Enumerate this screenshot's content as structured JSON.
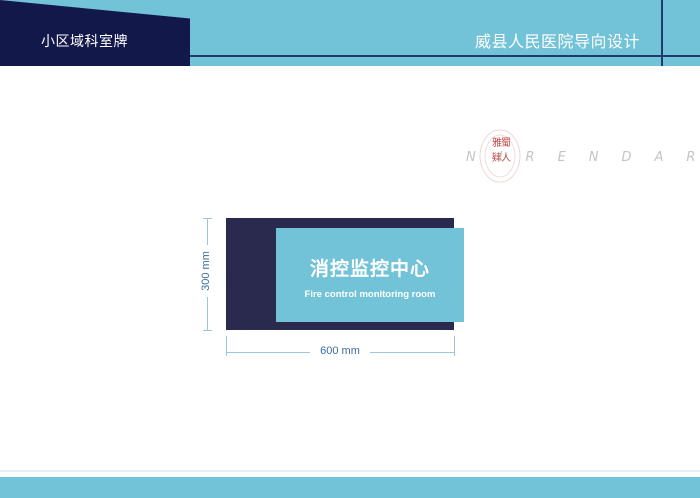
{
  "header": {
    "page_title": "小区域科室牌",
    "project_title": "威县人民医院导向设计"
  },
  "watermark": {
    "text": "NIRENDAR",
    "seal_text": "雅蜀肄人"
  },
  "sign": {
    "chinese_text": "消控监控中心",
    "english_text": "Fire control monitoring room"
  },
  "dimensions": {
    "height_label": "300 mm",
    "width_label": "600 mm"
  },
  "colors": {
    "accent": "#72c3d7",
    "navy": "#13184a",
    "sign_back": "#2a2a4e"
  }
}
